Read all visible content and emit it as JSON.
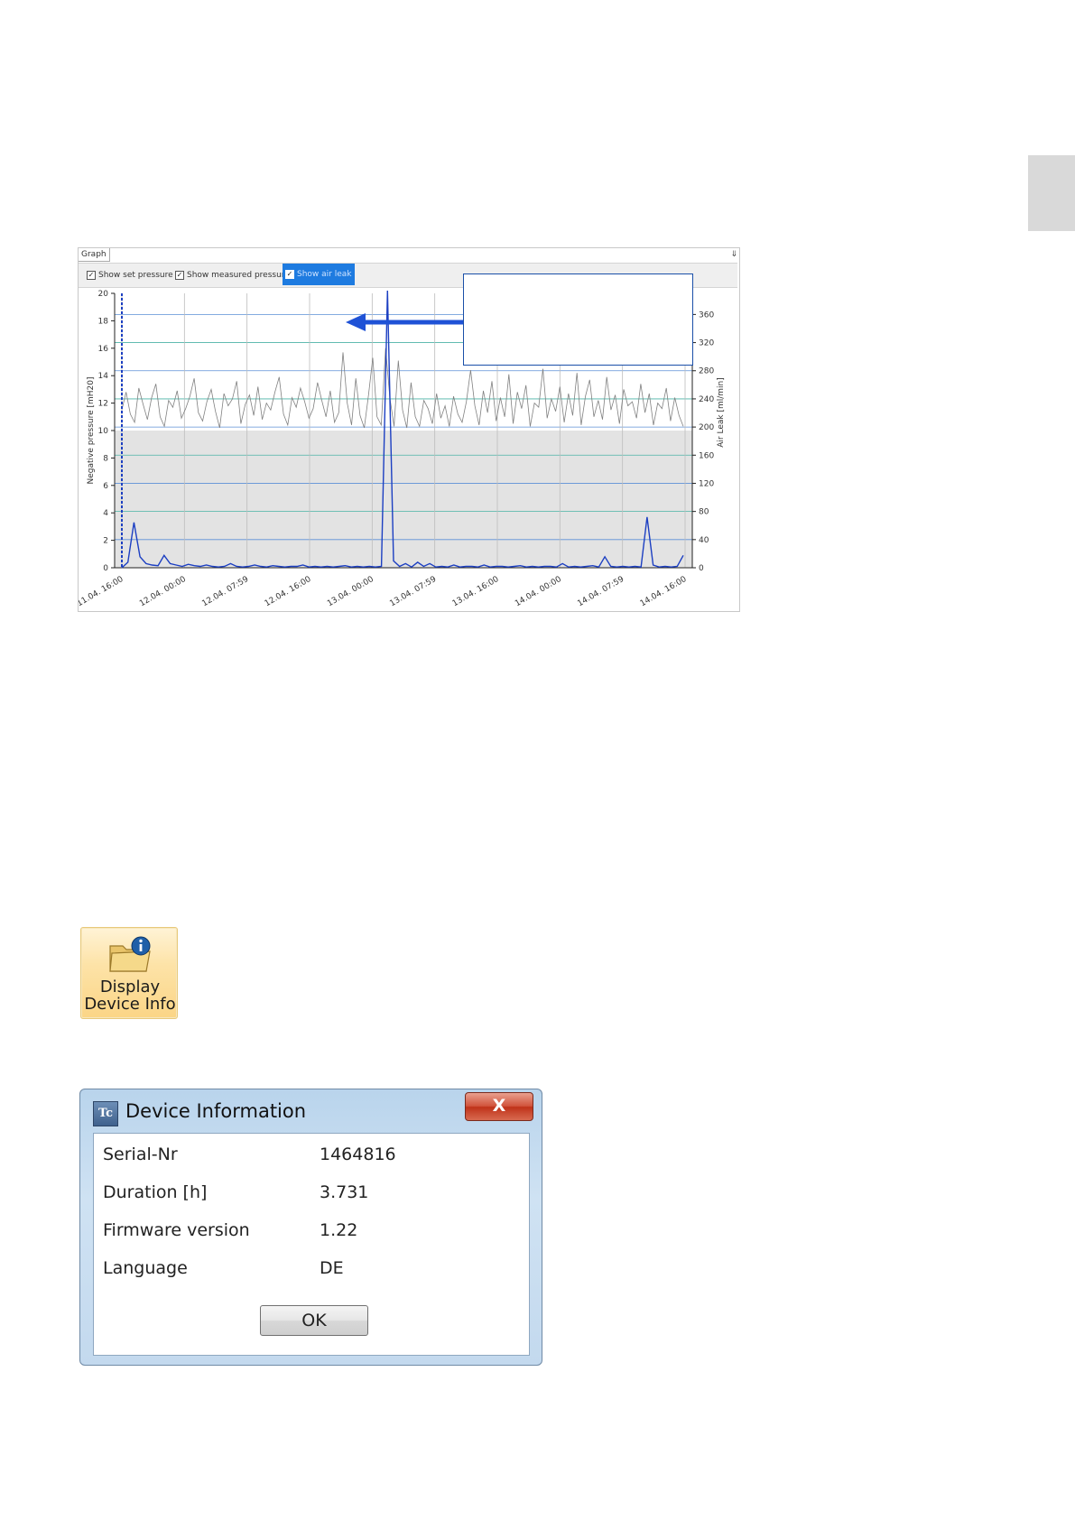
{
  "graph_panel": {
    "tab_label": "Graph",
    "pin_icon": "pin-icon",
    "options": [
      {
        "label": "Show set pressure",
        "checked": true,
        "selected": false
      },
      {
        "label": "Show measured pressure",
        "checked": true,
        "selected": false
      },
      {
        "label": "Show air leak",
        "checked": true,
        "selected": true
      }
    ]
  },
  "chart_data": {
    "type": "line",
    "ylabel_left": "Negative pressure [mH20]",
    "ylabel_right": "Air Leak [ml/min]",
    "y_left_ticks": [
      "0",
      "2",
      "4",
      "6",
      "8",
      "10",
      "12",
      "14",
      "16",
      "18",
      "20"
    ],
    "y_right_ticks": [
      "0",
      "40",
      "80",
      "120",
      "160",
      "200",
      "240",
      "280",
      "320",
      "360"
    ],
    "ylim_left": [
      0,
      20
    ],
    "ylim_right": [
      0,
      390
    ],
    "x_ticks": [
      "11.04. 16:00",
      "12.04. 00:00",
      "12.04. 07:59",
      "12.04. 16:00",
      "13.04. 00:00",
      "13.04. 07:59",
      "13.04. 16:00",
      "14.04. 00:00",
      "14.04. 07:59",
      "14.04. 16:00"
    ],
    "set_pressure": 10,
    "series": [
      {
        "color": "#808080",
        "values": [
          11.5,
          12.8,
          11.2,
          10.6,
          13.1,
          11.9,
          10.8,
          12.4,
          13.4,
          11.0,
          10.3,
          12.2,
          11.7,
          12.9,
          10.9,
          11.6,
          12.5,
          13.8,
          11.3,
          10.7,
          12.1,
          13.0,
          11.4,
          10.2,
          12.7,
          11.8,
          12.3,
          13.6,
          10.5,
          11.9,
          12.6,
          11.1,
          13.2,
          10.8,
          12.0,
          11.5,
          12.8,
          13.9,
          11.2,
          10.4,
          12.4,
          11.7,
          13.1,
          12.1,
          10.9,
          11.6,
          13.5,
          12.2,
          11.0,
          12.9,
          10.6,
          11.3,
          15.7,
          12.0,
          10.4,
          13.8,
          11.1,
          10.2,
          12.6,
          15.3,
          11.0,
          10.4,
          16.0,
          12.4,
          10.3,
          15.1,
          11.5,
          10.2,
          13.5,
          11.0,
          10.3,
          12.2,
          11.6,
          10.5,
          12.7,
          10.9,
          11.8,
          10.3,
          12.5,
          11.2,
          10.6,
          12.1,
          14.4,
          11.8,
          10.4,
          12.9,
          11.3,
          13.6,
          10.7,
          12.4,
          11.0,
          14.1,
          10.5,
          12.8,
          11.6,
          13.3,
          10.3,
          12.0,
          11.7,
          14.5,
          10.9,
          12.3,
          11.4,
          13.2,
          10.6,
          12.7,
          11.1,
          14.2,
          10.4,
          12.5,
          13.7,
          11.0,
          12.2,
          10.8,
          13.9,
          11.5,
          12.6,
          10.5,
          13.0,
          11.8,
          12.1,
          10.9,
          13.4,
          11.3,
          12.7,
          10.4,
          12.0,
          11.6,
          13.1,
          10.7,
          12.4,
          11.1,
          10.3
        ]
      },
      {
        "color": "#1c3fc2",
        "values": [
          0,
          0.4,
          3.3,
          0.8,
          0.3,
          0.2,
          0.15,
          0.9,
          0.3,
          0.2,
          0.1,
          0.25,
          0.15,
          0.1,
          0.2,
          0.1,
          0.05,
          0.1,
          0.3,
          0.1,
          0.05,
          0.1,
          0.2,
          0.1,
          0.05,
          0.15,
          0.1,
          0.05,
          0.1,
          0.1,
          0.2,
          0.05,
          0.1,
          0.05,
          0.1,
          0.05,
          0.1,
          0.15,
          0.05,
          0.1,
          0.05,
          0.1,
          0.05,
          0.1,
          20.2,
          0.5,
          0.1,
          0.3,
          0.05,
          0.4,
          0.1,
          0.3,
          0.05,
          0.1,
          0.05,
          0.2,
          0.05,
          0.1,
          0.1,
          0.05,
          0.2,
          0.05,
          0.1,
          0.1,
          0.05,
          0.1,
          0.15,
          0.05,
          0.1,
          0.05,
          0.1,
          0.1,
          0.05,
          0.3,
          0.05,
          0.1,
          0.05,
          0.1,
          0.15,
          0.05,
          0.8,
          0.1,
          0.05,
          0.1,
          0.05,
          0.1,
          0.05,
          3.7,
          0.2,
          0.05,
          0.1,
          0.05,
          0.1,
          0.9
        ]
      }
    ]
  },
  "devinfo_button": {
    "line1": "Display",
    "line2": "Device Info",
    "icon": "folder-info-icon"
  },
  "dialog": {
    "title": "Device Information",
    "close_label": "X",
    "app_icon": "app-icon",
    "rows": [
      {
        "label": "Serial-Nr",
        "value": "1464816"
      },
      {
        "label": "Duration [h]",
        "value": "3.731"
      },
      {
        "label": "Firmware version",
        "value": "1.22"
      },
      {
        "label": "Language",
        "value": "DE"
      }
    ],
    "ok_label": "OK"
  }
}
